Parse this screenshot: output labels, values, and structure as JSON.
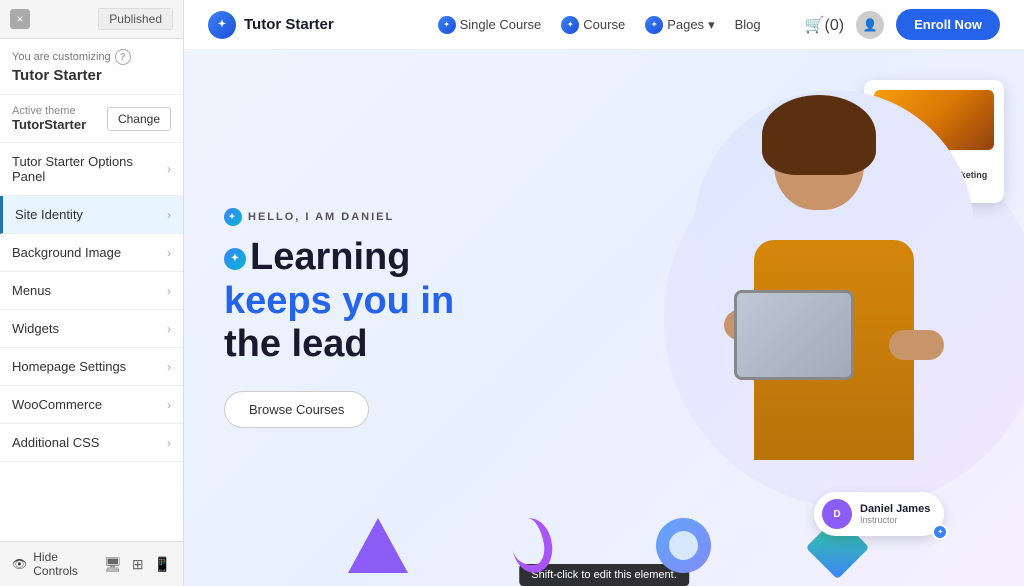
{
  "panel": {
    "close_icon": "×",
    "published_label": "Published",
    "customizing_label": "You are customizing",
    "customizing_title": "Tutor Starter",
    "help_icon": "?",
    "active_theme_label": "Active theme",
    "active_theme_name": "TutorStarter",
    "change_button": "Change",
    "menu_items": [
      {
        "label": "Tutor Starter Options Panel",
        "id": "options-panel"
      },
      {
        "label": "Site Identity",
        "id": "site-identity",
        "highlighted": true
      },
      {
        "label": "Background Image",
        "id": "background-image"
      },
      {
        "label": "Menus",
        "id": "menus"
      },
      {
        "label": "Widgets",
        "id": "widgets"
      },
      {
        "label": "Homepage Settings",
        "id": "homepage-settings"
      },
      {
        "label": "WooCommerce",
        "id": "woocommerce"
      },
      {
        "label": "Additional CSS",
        "id": "additional-css"
      }
    ],
    "hide_controls_label": "Hide Controls"
  },
  "nav": {
    "logo_icon": "✦",
    "logo_text": "Tutor Starter",
    "links": [
      {
        "label": "Single Course",
        "has_icon": true
      },
      {
        "label": "Course",
        "has_icon": true
      },
      {
        "label": "Pages",
        "has_dropdown": true
      },
      {
        "label": "Blog"
      }
    ],
    "cart_label": "(0)",
    "enroll_button": "Enroll Now"
  },
  "hero": {
    "hello_tag": "HELLO, I AM DANIEL",
    "title_line1": "Learning",
    "title_line2_blue": "keeps you in",
    "title_line3": "the lead",
    "browse_button": "Browse Courses",
    "course_card": {
      "stars": "★★★★",
      "title": "Email & Affiliate Marketing Mastermind"
    },
    "instructor": {
      "name": "Daniel James",
      "role": "Instructor"
    }
  },
  "tooltip": {
    "text": "Shift-click to edit this element."
  }
}
